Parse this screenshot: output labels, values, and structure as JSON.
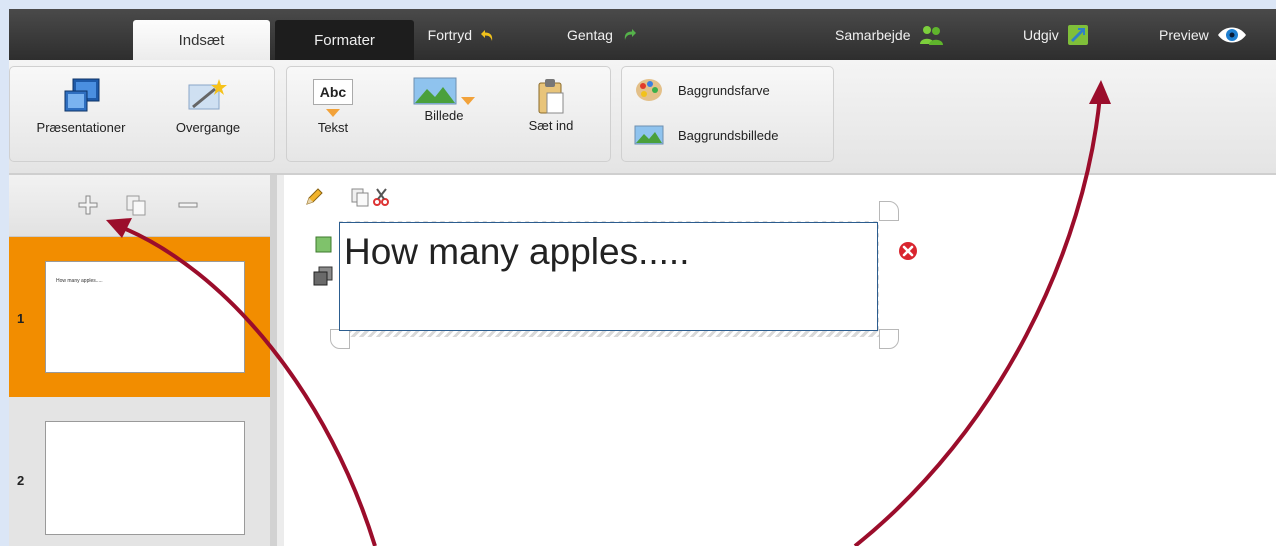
{
  "tabs": {
    "insert": "Indsæt",
    "format": "Formater"
  },
  "top_actions": {
    "undo": "Fortryd",
    "redo": "Gentag",
    "collaborate": "Samarbejde",
    "publish": "Udgiv",
    "preview": "Preview"
  },
  "ribbon": {
    "presentations": "Præsentationer",
    "transitions": "Overgange",
    "text": "Tekst",
    "text_icon": "Abc",
    "image": "Billede",
    "paste": "Sæt ind",
    "bg_color": "Baggrundsfarve",
    "bg_image": "Baggrundsbillede"
  },
  "slides": [
    {
      "number": "1",
      "text": "How many apples....."
    },
    {
      "number": "2",
      "text": ""
    }
  ],
  "canvas": {
    "textbox_text": "How many apples....."
  },
  "icons": {
    "undo": "undo-arrow-icon",
    "redo": "redo-arrow-icon",
    "collaborate": "people-icon",
    "publish": "publish-icon",
    "preview": "eye-icon",
    "add_slide": "plus-icon",
    "duplicate_slide": "copy-icon",
    "remove_slide": "minus-icon",
    "edit": "pencil-icon",
    "copy": "copy-icon",
    "cut": "scissors-icon",
    "delete": "close-icon"
  },
  "colors": {
    "selected_slide": "#f28d00",
    "annotation_arrow": "#9b0d2b",
    "delete_button": "#d9252f"
  }
}
